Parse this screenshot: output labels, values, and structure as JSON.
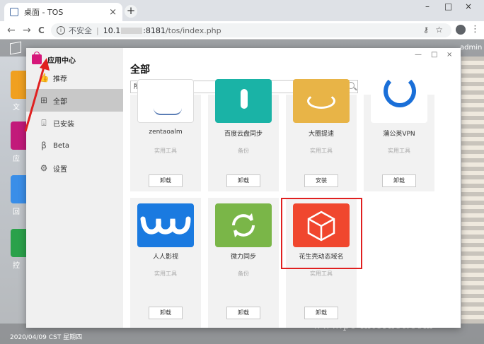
{
  "browser": {
    "tab_title": "桌面 - TOS",
    "tab_close": "×",
    "new_tab": "+",
    "minimize": "–",
    "maximize": "□",
    "close": "×",
    "back": "←",
    "forward": "→",
    "reload": "C",
    "security_text": "不安全",
    "url_host": "10.1",
    "url_masked": ":8181",
    "url_path": "/tos/index.php",
    "menu": "⋮"
  },
  "desktop": {
    "user": "admin",
    "icon_labels": [
      "文",
      "应",
      "回",
      "控"
    ],
    "clock": "2020/04/09 CST 星期四",
    "watermark": "www.pc-internet.com"
  },
  "app": {
    "header_title": "应用中心",
    "sidebar": [
      {
        "label": "推荐",
        "icon": "thumbs-up-icon"
      },
      {
        "label": "全部",
        "icon": "grid-icon"
      },
      {
        "label": "已安装",
        "icon": "download-box-icon"
      },
      {
        "label": "Beta",
        "icon": "beta-icon"
      },
      {
        "label": "设置",
        "icon": "gear-icon"
      }
    ],
    "window_controls": {
      "minimize": "—",
      "maximize": "□",
      "close": "×"
    },
    "main_title": "全部",
    "filter_value": "所有",
    "search_placeholder": "",
    "apps": [
      {
        "name": "zentaoalm",
        "category": "实用工具",
        "button": "卸载",
        "color": "#ffffff"
      },
      {
        "name": "百度云盘同步",
        "category": "备份",
        "button": "卸载",
        "color": "#1ab3a6"
      },
      {
        "name": "大圈提速",
        "category": "实用工具",
        "button": "安装",
        "color": "#e8b447"
      },
      {
        "name": "蒲公英VPN",
        "category": "实用工具",
        "button": "卸载",
        "color": "#ffffff"
      },
      {
        "name": "人人影视",
        "category": "实用工具",
        "button": "卸载",
        "color": "#1a7ae0"
      },
      {
        "name": "微力同步",
        "category": "备份",
        "button": "卸载",
        "color": "#7ab648"
      },
      {
        "name": "花生壳动态域名",
        "category": "实用工具",
        "button": "卸载",
        "color": "#f0472e"
      }
    ]
  }
}
